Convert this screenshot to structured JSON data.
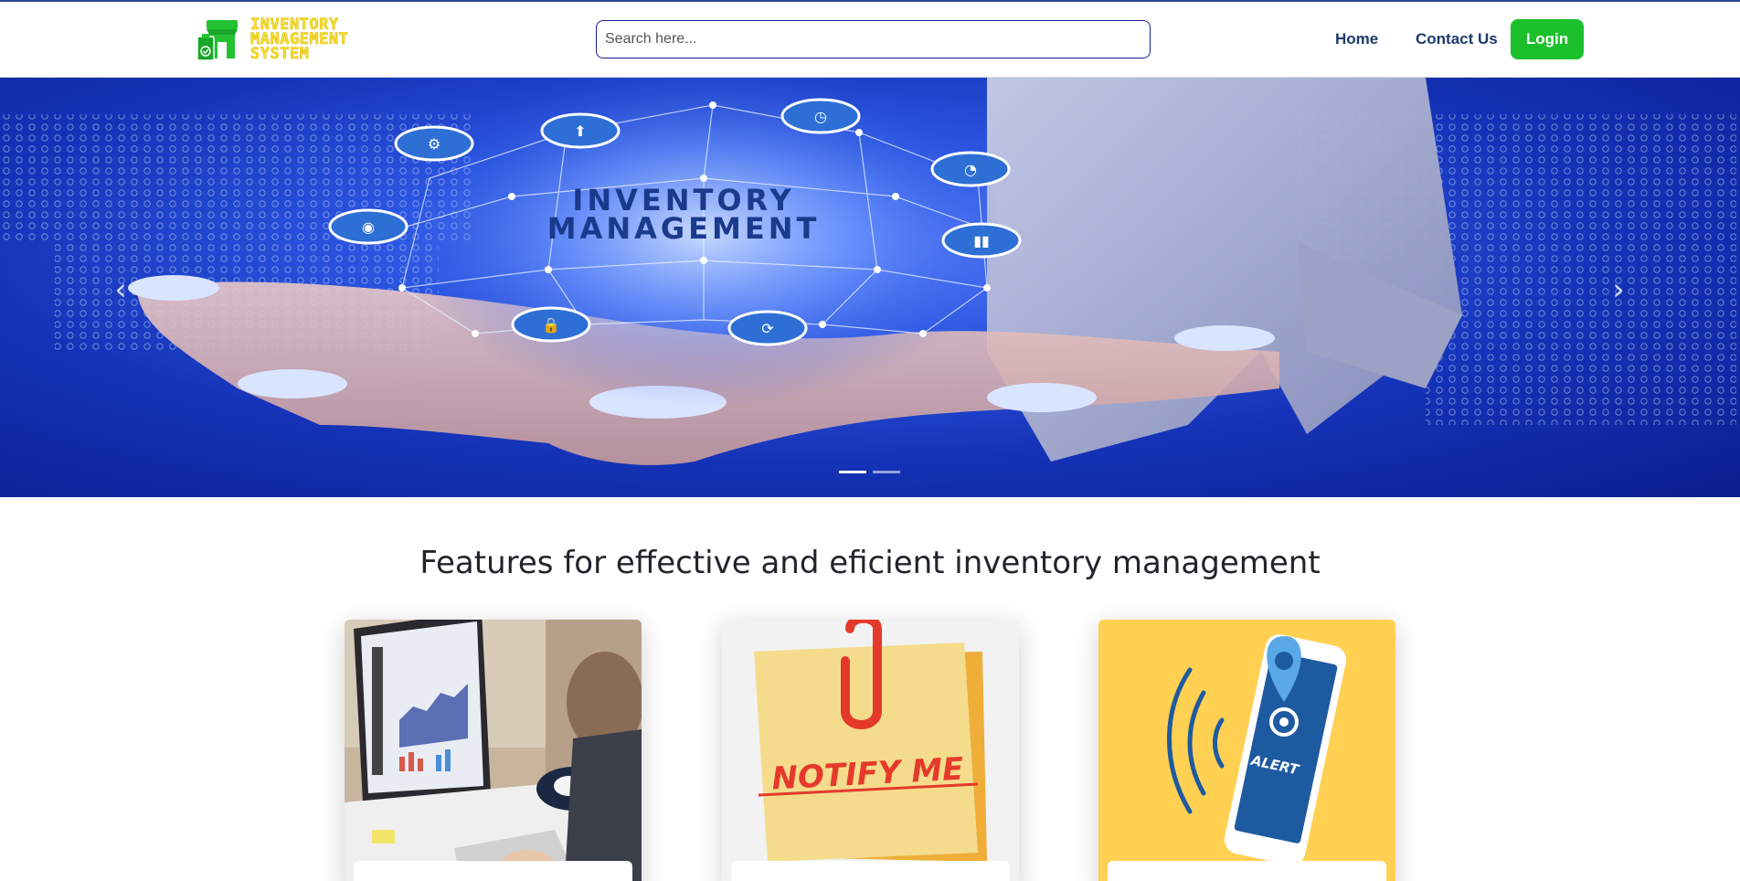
{
  "header": {
    "logo": {
      "line1": "INVENTORY",
      "line2": "MANAGEMENT",
      "line3": "SYSTEM",
      "icon": "store-clipboard-icon"
    },
    "search": {
      "placeholder": "Search here...",
      "value": ""
    },
    "nav": {
      "home": "Home",
      "contact": "Contact Us"
    },
    "login_label": "Login"
  },
  "hero": {
    "image_text_line1": "INVENTORY",
    "image_text_line2": "MANAGEMENT",
    "slides_count": 2,
    "active_slide": 1,
    "prev_icon": "chevron-left-icon",
    "next_icon": "chevron-right-icon",
    "prev_glyph": "‹",
    "next_glyph": "›"
  },
  "features": {
    "title": "Features for effective and eficient inventory management",
    "cards": [
      {
        "image": "analytics-desk-image"
      },
      {
        "image": "notify-me-note-image",
        "image_text": "NOTIFY ME"
      },
      {
        "image": "phone-alert-image",
        "image_text": "ALERT"
      }
    ]
  },
  "colors": {
    "accent_green": "#1bbf2b",
    "nav_text": "#1f3a6b",
    "search_border": "#1b1f8f",
    "logo_yellow": "#f4e23a",
    "hero_blue": "#1533b8"
  }
}
